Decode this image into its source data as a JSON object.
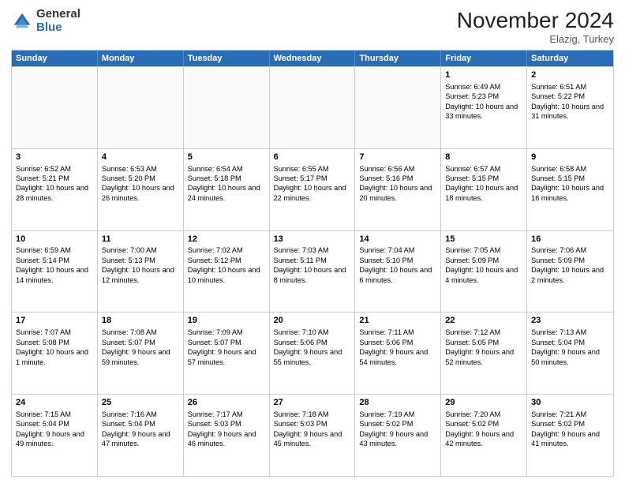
{
  "header": {
    "logo_general": "General",
    "logo_blue": "Blue",
    "title": "November 2024",
    "location": "Elazig, Turkey"
  },
  "weekdays": [
    "Sunday",
    "Monday",
    "Tuesday",
    "Wednesday",
    "Thursday",
    "Friday",
    "Saturday"
  ],
  "rows": [
    [
      {
        "day": "",
        "content": ""
      },
      {
        "day": "",
        "content": ""
      },
      {
        "day": "",
        "content": ""
      },
      {
        "day": "",
        "content": ""
      },
      {
        "day": "",
        "content": ""
      },
      {
        "day": "1",
        "content": "Sunrise: 6:49 AM\nSunset: 5:23 PM\nDaylight: 10 hours and 33 minutes."
      },
      {
        "day": "2",
        "content": "Sunrise: 6:51 AM\nSunset: 5:22 PM\nDaylight: 10 hours and 31 minutes."
      }
    ],
    [
      {
        "day": "3",
        "content": "Sunrise: 6:52 AM\nSunset: 5:21 PM\nDaylight: 10 hours and 28 minutes."
      },
      {
        "day": "4",
        "content": "Sunrise: 6:53 AM\nSunset: 5:20 PM\nDaylight: 10 hours and 26 minutes."
      },
      {
        "day": "5",
        "content": "Sunrise: 6:54 AM\nSunset: 5:18 PM\nDaylight: 10 hours and 24 minutes."
      },
      {
        "day": "6",
        "content": "Sunrise: 6:55 AM\nSunset: 5:17 PM\nDaylight: 10 hours and 22 minutes."
      },
      {
        "day": "7",
        "content": "Sunrise: 6:56 AM\nSunset: 5:16 PM\nDaylight: 10 hours and 20 minutes."
      },
      {
        "day": "8",
        "content": "Sunrise: 6:57 AM\nSunset: 5:15 PM\nDaylight: 10 hours and 18 minutes."
      },
      {
        "day": "9",
        "content": "Sunrise: 6:58 AM\nSunset: 5:15 PM\nDaylight: 10 hours and 16 minutes."
      }
    ],
    [
      {
        "day": "10",
        "content": "Sunrise: 6:59 AM\nSunset: 5:14 PM\nDaylight: 10 hours and 14 minutes."
      },
      {
        "day": "11",
        "content": "Sunrise: 7:00 AM\nSunset: 5:13 PM\nDaylight: 10 hours and 12 minutes."
      },
      {
        "day": "12",
        "content": "Sunrise: 7:02 AM\nSunset: 5:12 PM\nDaylight: 10 hours and 10 minutes."
      },
      {
        "day": "13",
        "content": "Sunrise: 7:03 AM\nSunset: 5:11 PM\nDaylight: 10 hours and 8 minutes."
      },
      {
        "day": "14",
        "content": "Sunrise: 7:04 AM\nSunset: 5:10 PM\nDaylight: 10 hours and 6 minutes."
      },
      {
        "day": "15",
        "content": "Sunrise: 7:05 AM\nSunset: 5:09 PM\nDaylight: 10 hours and 4 minutes."
      },
      {
        "day": "16",
        "content": "Sunrise: 7:06 AM\nSunset: 5:09 PM\nDaylight: 10 hours and 2 minutes."
      }
    ],
    [
      {
        "day": "17",
        "content": "Sunrise: 7:07 AM\nSunset: 5:08 PM\nDaylight: 10 hours and 1 minute."
      },
      {
        "day": "18",
        "content": "Sunrise: 7:08 AM\nSunset: 5:07 PM\nDaylight: 9 hours and 59 minutes."
      },
      {
        "day": "19",
        "content": "Sunrise: 7:09 AM\nSunset: 5:07 PM\nDaylight: 9 hours and 57 minutes."
      },
      {
        "day": "20",
        "content": "Sunrise: 7:10 AM\nSunset: 5:06 PM\nDaylight: 9 hours and 55 minutes."
      },
      {
        "day": "21",
        "content": "Sunrise: 7:11 AM\nSunset: 5:06 PM\nDaylight: 9 hours and 54 minutes."
      },
      {
        "day": "22",
        "content": "Sunrise: 7:12 AM\nSunset: 5:05 PM\nDaylight: 9 hours and 52 minutes."
      },
      {
        "day": "23",
        "content": "Sunrise: 7:13 AM\nSunset: 5:04 PM\nDaylight: 9 hours and 50 minutes."
      }
    ],
    [
      {
        "day": "24",
        "content": "Sunrise: 7:15 AM\nSunset: 5:04 PM\nDaylight: 9 hours and 49 minutes."
      },
      {
        "day": "25",
        "content": "Sunrise: 7:16 AM\nSunset: 5:04 PM\nDaylight: 9 hours and 47 minutes."
      },
      {
        "day": "26",
        "content": "Sunrise: 7:17 AM\nSunset: 5:03 PM\nDaylight: 9 hours and 46 minutes."
      },
      {
        "day": "27",
        "content": "Sunrise: 7:18 AM\nSunset: 5:03 PM\nDaylight: 9 hours and 45 minutes."
      },
      {
        "day": "28",
        "content": "Sunrise: 7:19 AM\nSunset: 5:02 PM\nDaylight: 9 hours and 43 minutes."
      },
      {
        "day": "29",
        "content": "Sunrise: 7:20 AM\nSunset: 5:02 PM\nDaylight: 9 hours and 42 minutes."
      },
      {
        "day": "30",
        "content": "Sunrise: 7:21 AM\nSunset: 5:02 PM\nDaylight: 9 hours and 41 minutes."
      }
    ]
  ]
}
